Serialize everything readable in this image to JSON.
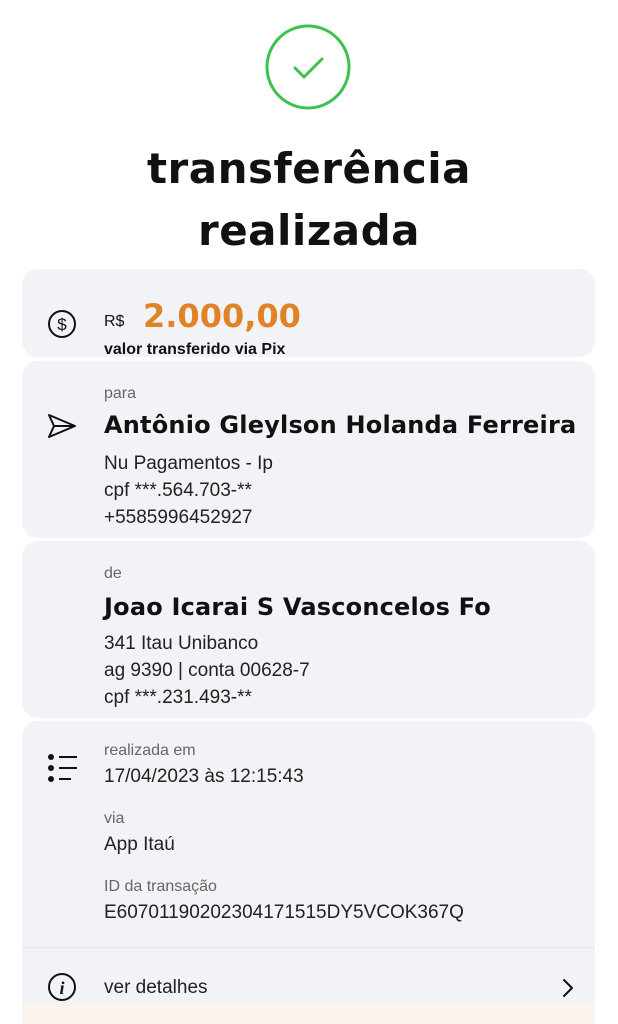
{
  "header": {
    "title_line1": "transferência",
    "title_line2": "realizada"
  },
  "colors": {
    "success": "#3dc24b",
    "amount": "#e08327",
    "card_bg": "#f2f3f6"
  },
  "amount": {
    "currency": "R$",
    "value": "2.000,00",
    "subtitle": "valor transferido via Pix",
    "icon": "dollar-icon"
  },
  "recipient": {
    "label": "para",
    "name": "Antônio Gleylson Holanda Ferreira",
    "bank": " Nu Pagamentos - Ip",
    "cpf": "cpf ***.564.703-**",
    "phone": "+5585996452927",
    "icon": "send-icon"
  },
  "sender": {
    "label": "de",
    "name": "Joao Icarai S Vasconcelos Fo",
    "bank": "341 Itau Unibanco",
    "account": "ag 9390 | conta 00628-7",
    "cpf": "cpf ***.231.493-**"
  },
  "details": {
    "icon": "list-icon",
    "date_label": "realizada em",
    "date_value": "17/04/2023 às 12:15:43",
    "via_label": "via",
    "via_value": "App Itaú",
    "id_label": "ID da transação",
    "id_value": "E60701190202304171515DY5VCOK367Q"
  },
  "footer": {
    "details_link": "ver detalhes",
    "icon": "info-icon"
  }
}
